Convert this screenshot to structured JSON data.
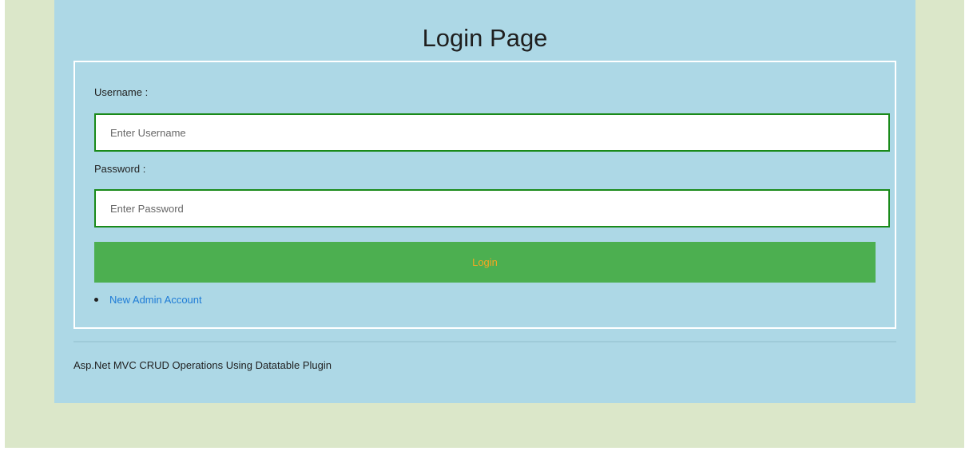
{
  "page": {
    "title": "Login Page"
  },
  "form": {
    "username_label": "Username :",
    "username_placeholder": "Enter Username",
    "username_value": "",
    "password_label": "Password :",
    "password_placeholder": "Enter Password",
    "password_value": "",
    "login_button_label": "Login",
    "links": [
      {
        "label": "New Admin Account"
      }
    ]
  },
  "footer": {
    "text": "Asp.Net MVC CRUD Operations Using Datatable Plugin"
  },
  "colors": {
    "page_background": "#dbe7c9",
    "panel_background": "#add8e6",
    "input_border": "#1a8a1a",
    "button_background": "#4caf50",
    "button_text": "#f5a623",
    "link": "#1e7bd6"
  }
}
